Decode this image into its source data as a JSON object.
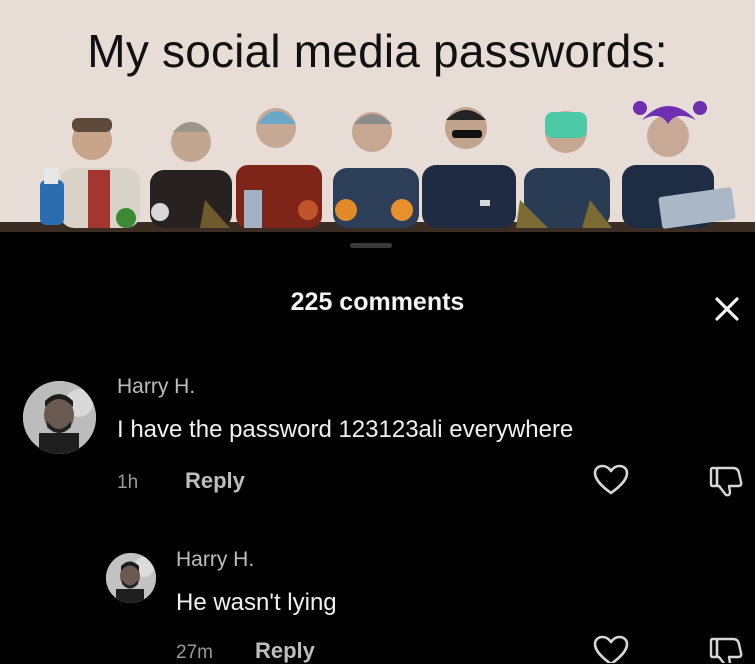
{
  "meme": {
    "title": "My social media passwords:"
  },
  "comments_panel": {
    "title": "225 comments",
    "close_icon": "close-icon",
    "comments": [
      {
        "author": "Harry H.",
        "text": "I have the password 123123ali everywhere",
        "time": "1h",
        "reply_label": "Reply"
      },
      {
        "author": "Harry H.",
        "text": "He wasn't lying",
        "time": "27m",
        "reply_label": "Reply"
      }
    ]
  },
  "colors": {
    "background": "#000000",
    "meme_background": "#e7dcd6",
    "text_primary": "#f0f0f0",
    "text_secondary": "#bdbdbd"
  }
}
